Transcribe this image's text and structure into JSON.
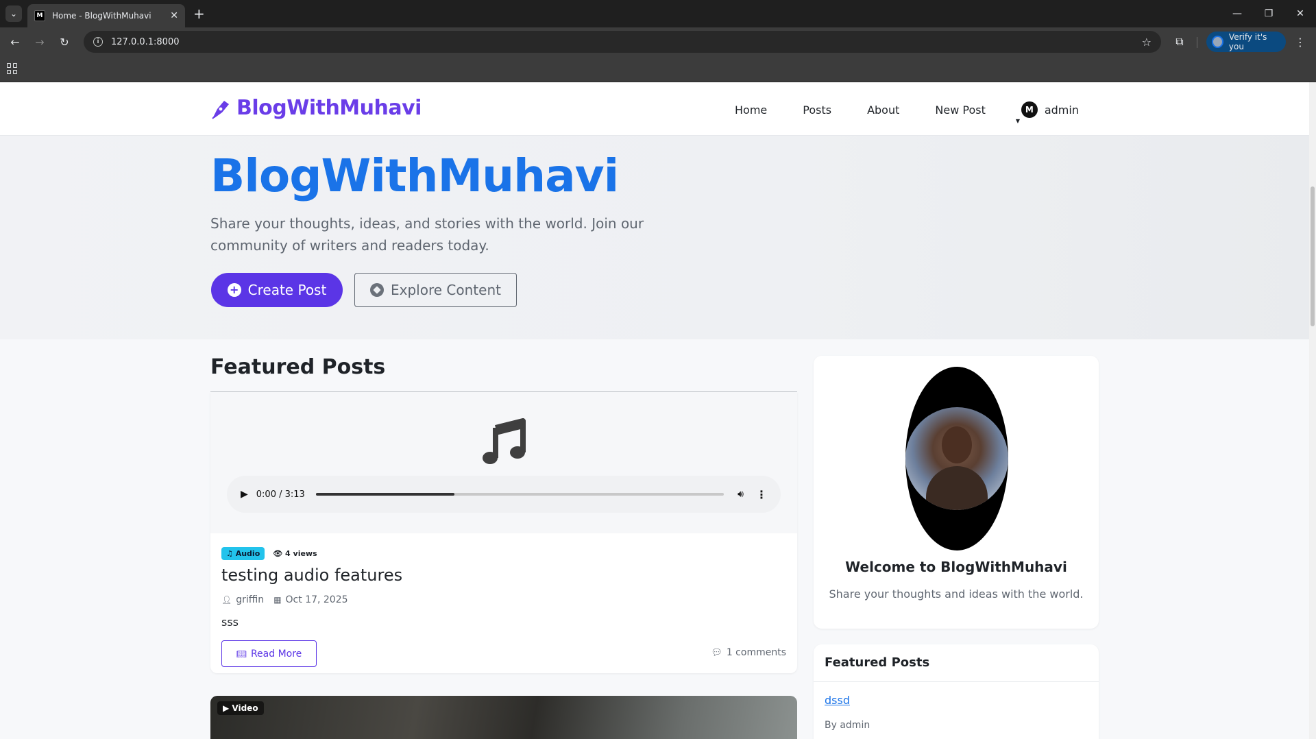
{
  "browser": {
    "tab_title": "Home - BlogWithMuhavi",
    "favicon_text": "M",
    "url": "127.0.0.1:8000",
    "verify_label": "Verify it's you"
  },
  "nav": {
    "brand": "BlogWithMuhavi",
    "links": [
      "Home",
      "Posts",
      "About",
      "New Post"
    ],
    "user_initial": "M",
    "user_name": "admin"
  },
  "hero": {
    "title": "BlogWithMuhavi",
    "subtitle": "Share your thoughts, ideas, and stories with the world. Join our community of writers and readers today.",
    "primary_button": "Create Post",
    "secondary_button": "Explore Content"
  },
  "main": {
    "section_title": "Featured Posts",
    "posts": [
      {
        "audio_time": "0:00 / 3:13",
        "audio_progress_fraction": 0.34,
        "badge": "Audio",
        "views": "4 views",
        "title": "testing audio features",
        "author": "griffin",
        "date": "Oct 17, 2025",
        "excerpt": "sss",
        "read_more": "Read More",
        "comments": "1 comments"
      },
      {
        "badge": "Video"
      }
    ]
  },
  "sidebar": {
    "welcome_title": "Welcome to BlogWithMuhavi",
    "welcome_sub": "Share your thoughts and ideas with the world.",
    "featured_title": "Featured Posts",
    "featured_items": [
      {
        "title": "dssd",
        "by": "By admin"
      }
    ]
  },
  "colors": {
    "brand_purple": "#6a3de8",
    "hero_blue": "#1a73e8",
    "primary_button": "#5b35e6",
    "audio_badge": "#22c3ec"
  }
}
